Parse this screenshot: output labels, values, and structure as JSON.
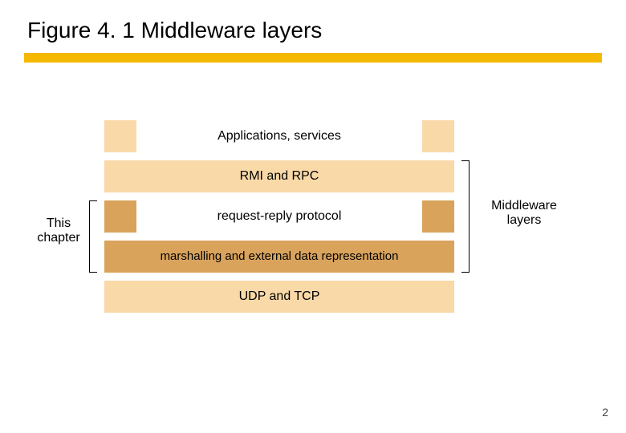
{
  "title": "Figure 4. 1 Middleware layers",
  "layers": {
    "applications": "Applications, services",
    "rmi_rpc": "RMI and RPC",
    "request_reply": "request-reply protocol",
    "marshalling": "marshalling and external data representation",
    "udp_tcp": "UDP and TCP"
  },
  "leftCaption": {
    "line1": "This",
    "line2": "chapter"
  },
  "rightCaption": {
    "line1": "Middleware",
    "line2": "layers"
  },
  "pageNumber": "2"
}
